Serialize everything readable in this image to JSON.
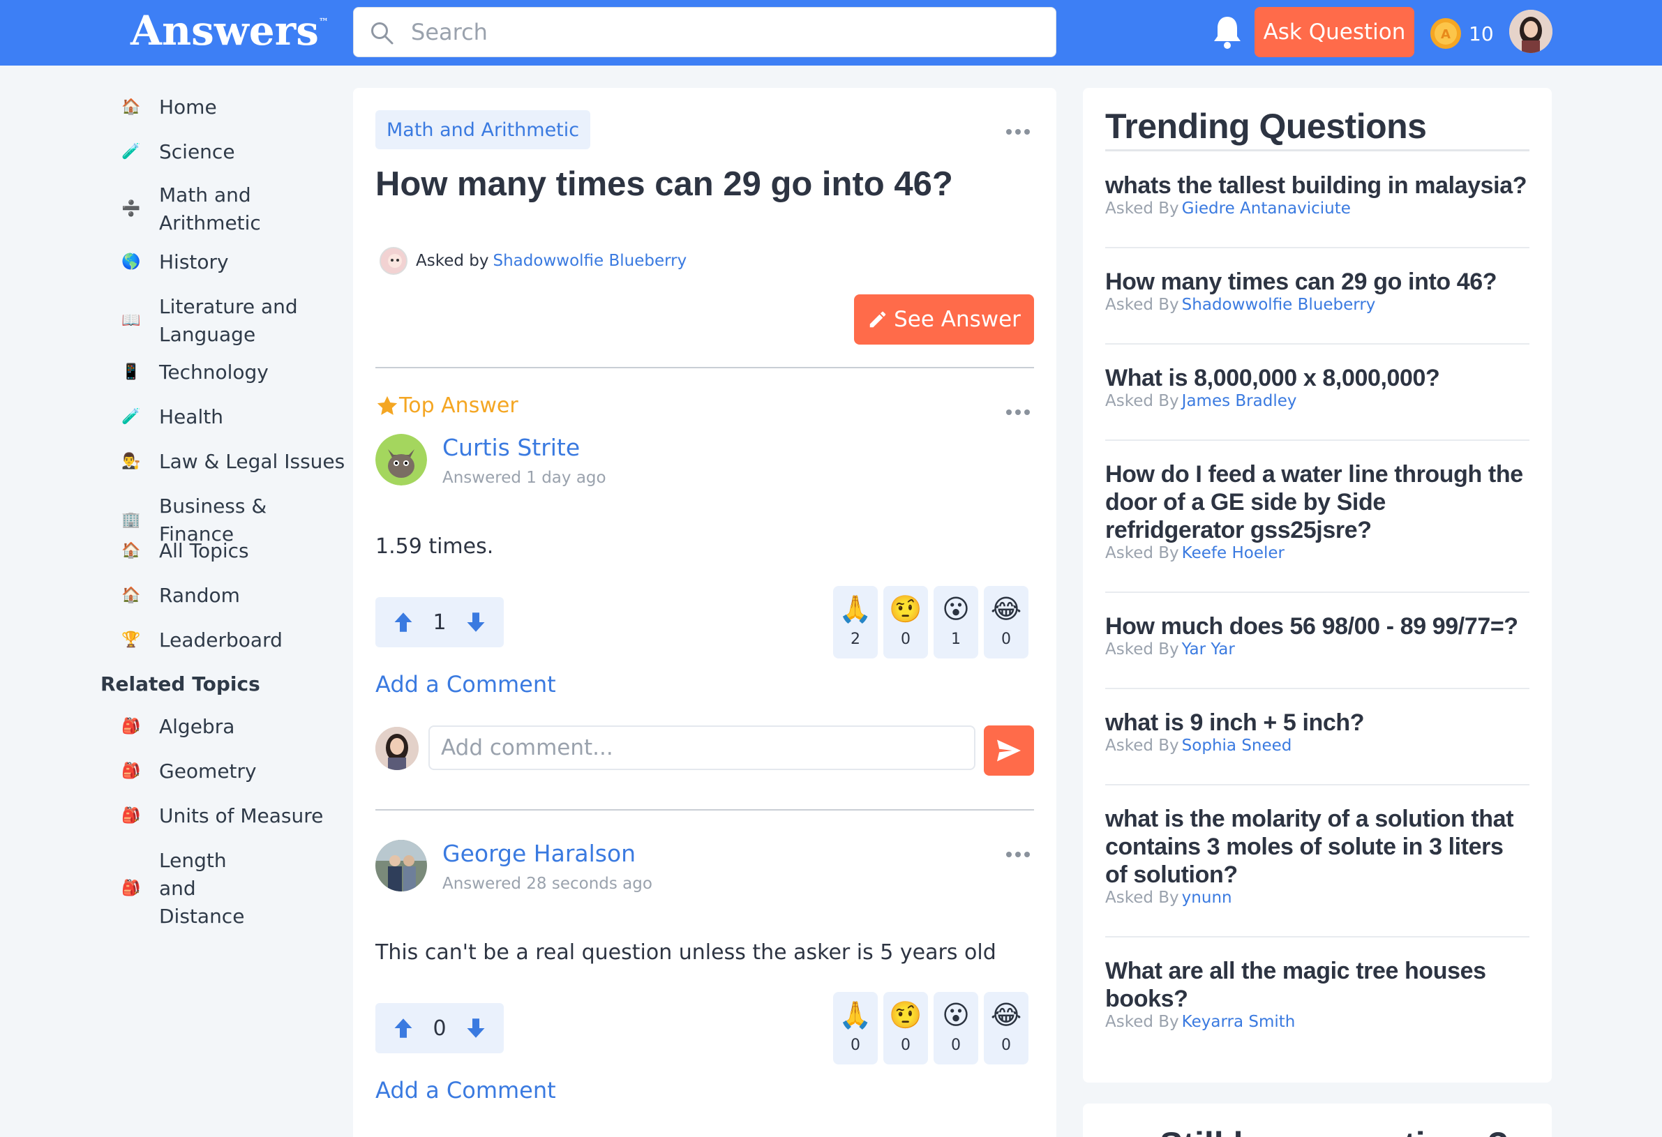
{
  "header": {
    "logo": "Answers",
    "logo_tm": "™",
    "search_placeholder": "Search",
    "ask_label": "Ask Question",
    "coin_count": "10"
  },
  "sidebar": {
    "items": [
      {
        "icon": "🏠",
        "label": "Home"
      },
      {
        "icon": "🧪",
        "label": "Science"
      },
      {
        "icon": "➗",
        "label": "Math and Arithmetic"
      },
      {
        "icon": "🌎",
        "label": "History"
      },
      {
        "icon": "📖",
        "label": "Literature and Language"
      },
      {
        "icon": "📱",
        "label": "Technology"
      },
      {
        "icon": "🧪",
        "label": "Health"
      },
      {
        "icon": "👨‍⚖️",
        "label": "Law & Legal Issues"
      },
      {
        "icon": "🏢",
        "label": "Business & Finance"
      },
      {
        "icon": "🏠",
        "label": "All Topics"
      },
      {
        "icon": "🏠",
        "label": "Random"
      },
      {
        "icon": "🏆",
        "label": "Leaderboard"
      }
    ],
    "related_heading": "Related Topics",
    "related": [
      {
        "icon": "🎒",
        "label": "Algebra"
      },
      {
        "icon": "🎒",
        "label": "Geometry"
      },
      {
        "icon": "🎒",
        "label": "Units of Measure"
      },
      {
        "icon": "🎒",
        "label": "Length and Distance"
      }
    ]
  },
  "question": {
    "category": "Math and Arithmetic",
    "title": "How many times can 29 go into 46?",
    "asked_by_prefix": "Asked by",
    "asker": "Shadowwolfie Blueberry",
    "see_answer": "See Answer"
  },
  "answers": [
    {
      "top_label": "Top Answer",
      "author": "Curtis Strite",
      "time": "Answered 1 day ago",
      "text": "1.59 times.",
      "votes": "1",
      "reactions": [
        {
          "emoji": "🙏",
          "count": "2"
        },
        {
          "emoji": "🤨",
          "count": "0"
        },
        {
          "emoji": "😮",
          "count": "1"
        },
        {
          "emoji": "😂",
          "count": "0"
        }
      ],
      "add_comment": "Add a Comment",
      "comment_placeholder": "Add comment..."
    },
    {
      "author": "George Haralson",
      "time": "Answered 28 seconds ago",
      "text": "This can't be a real question unless the asker is 5 years old",
      "votes": "0",
      "reactions": [
        {
          "emoji": "🙏",
          "count": "0"
        },
        {
          "emoji": "🤨",
          "count": "0"
        },
        {
          "emoji": "😮",
          "count": "0"
        },
        {
          "emoji": "😂",
          "count": "0"
        }
      ],
      "add_comment": "Add a Comment"
    }
  ],
  "trending": {
    "heading": "Trending Questions",
    "asked_by_prefix": "Asked By",
    "items": [
      {
        "q": "whats the tallest building in malaysia?",
        "by": "Giedre Antanaviciute"
      },
      {
        "q": "How many times can 29 go into 46?",
        "by": "Shadowwolfie Blueberry"
      },
      {
        "q": "What is 8,000,000 x 8,000,000?",
        "by": "James Bradley"
      },
      {
        "q": "How do I feed a water line through the door of a GE side by Side refridgerator gss25jsre?",
        "by": "Keefe Hoeler"
      },
      {
        "q": "How much does 56 98/00 - 89 99/77=?",
        "by": "Yar Yar"
      },
      {
        "q": "what is 9 inch + 5 inch?",
        "by": "Sophia Sneed"
      },
      {
        "q": "what is the molarity of a solution that contains 3 moles of solute in 3 liters of solution?",
        "by": "ynunn"
      },
      {
        "q": "What are all the magic tree houses books?",
        "by": "Keyarra Smith"
      }
    ]
  },
  "still_card": {
    "title": "Still have questions?"
  },
  "colors": {
    "brand_blue": "#3d7ff5",
    "accent_orange": "#ff6b4a",
    "link_blue": "#3a7ae0",
    "gold": "#f4a623"
  }
}
